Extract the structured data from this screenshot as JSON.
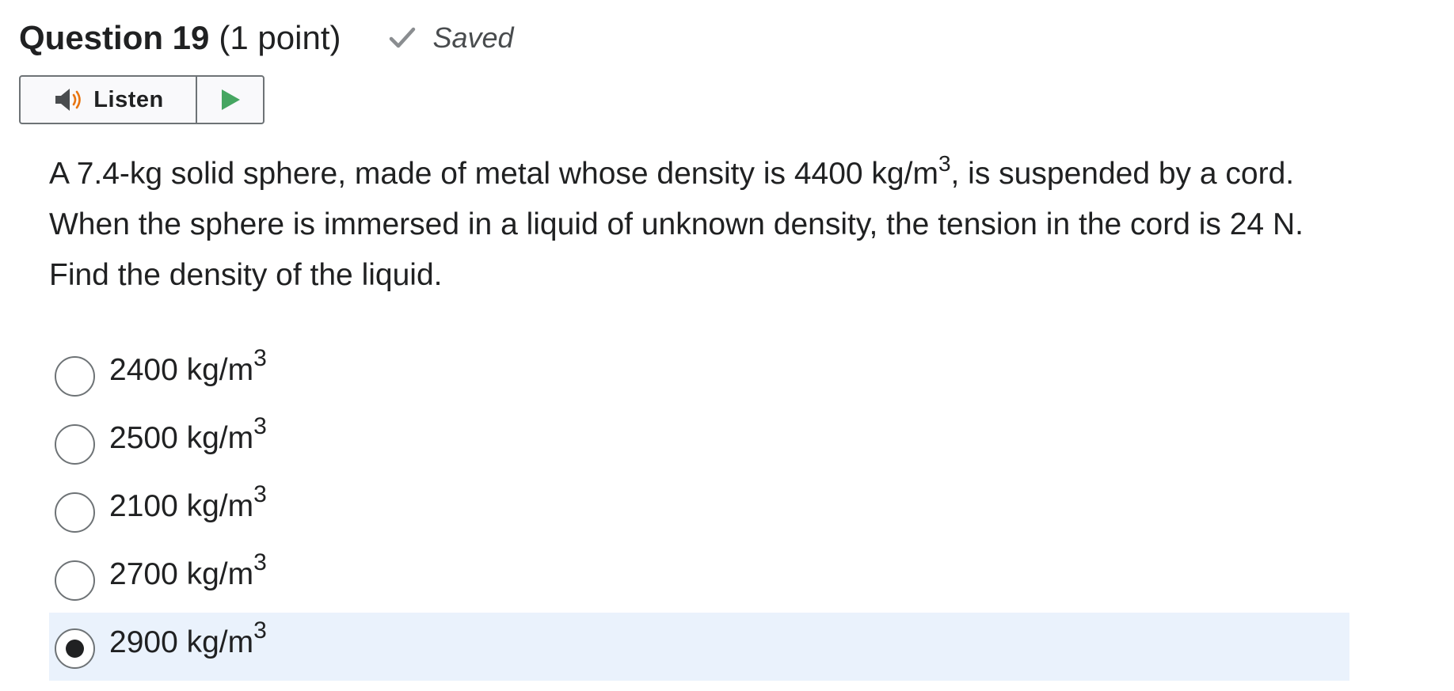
{
  "question": {
    "title": "Question 19",
    "points": "(1 point)",
    "status": "Saved"
  },
  "listen": {
    "label": "Listen"
  },
  "stem": {
    "part1": "A 7.4-kg solid sphere, made of metal whose density is 4400 kg/m",
    "sup1": "3",
    "part2": ", is suspended by a cord. When the sphere is immersed in a liquid of unknown density, the tension in the cord is 24 N. Find the density of the liquid."
  },
  "options": [
    {
      "value": "2400 kg/m",
      "exponent": "3",
      "selected": false
    },
    {
      "value": "2500 kg/m",
      "exponent": "3",
      "selected": false
    },
    {
      "value": "2100 kg/m",
      "exponent": "3",
      "selected": false
    },
    {
      "value": "2700 kg/m",
      "exponent": "3",
      "selected": false
    },
    {
      "value": "2900 kg/m",
      "exponent": "3",
      "selected": true
    }
  ],
  "colors": {
    "selected_row": "#eaf2fc",
    "check": "#8a8d90",
    "speaker": "#494c4e",
    "speaker_waves": "#e87511",
    "play": "#46a661"
  },
  "icons": {
    "status": "checkmark-icon",
    "listen": "speaker-icon",
    "play": "play-icon"
  }
}
